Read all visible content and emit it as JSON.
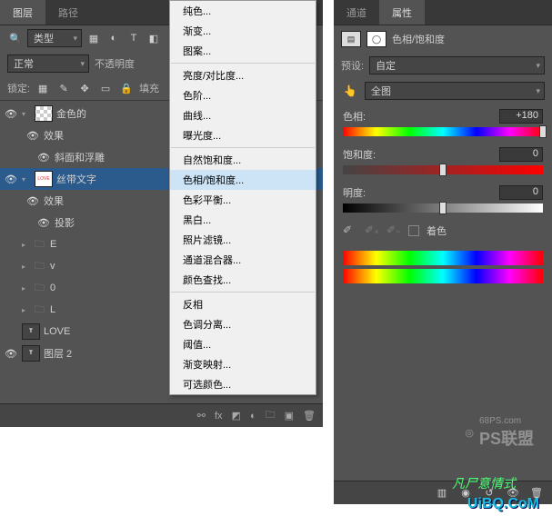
{
  "left": {
    "tabs": {
      "t1": "图层",
      "t2": "路径"
    },
    "typeRow": {
      "search": "",
      "type": "类型"
    },
    "blend": {
      "mode": "正常",
      "opacity": "不透明度"
    },
    "lock": {
      "label": "锁定:",
      "fill": "填充"
    },
    "layers": {
      "l1": "金色的",
      "l1fx": "效果",
      "l1bevel": "斜面和浮雕",
      "l2": "丝带文字",
      "l2fx": "效果",
      "l2shadow": "投影",
      "gE": "E",
      "gV": "v",
      "g0": "0",
      "gL": "L",
      "tLove": "LOVE",
      "tLayer": "图层 2"
    }
  },
  "menu": {
    "m1": "纯色...",
    "m2": "渐变...",
    "m3": "图案...",
    "m4": "亮度/对比度...",
    "m5": "色阶...",
    "m6": "曲线...",
    "m7": "曝光度...",
    "m8": "自然饱和度...",
    "m9": "色相/饱和度...",
    "m10": "色彩平衡...",
    "m11": "黑白...",
    "m12": "照片滤镜...",
    "m13": "通道混合器...",
    "m14": "颜色查找...",
    "m15": "反相",
    "m16": "色调分离...",
    "m17": "阈值...",
    "m18": "渐变映射...",
    "m19": "可选颜色..."
  },
  "right": {
    "tabs": {
      "t1": "通道",
      "t2": "属性"
    },
    "title": "色相/饱和度",
    "preset": {
      "label": "预设:",
      "value": "自定"
    },
    "range": {
      "value": "全图"
    },
    "hue": {
      "label": "色相:",
      "value": "+180"
    },
    "sat": {
      "label": "饱和度:",
      "value": "0"
    },
    "bright": {
      "label": "明度:",
      "value": "0"
    },
    "colorize": "着色"
  },
  "watermark": {
    "site": "68PS.com",
    "brand": "PS联盟",
    "uibq": "UiBQ.CoM",
    "green": "凡尸意情式"
  }
}
